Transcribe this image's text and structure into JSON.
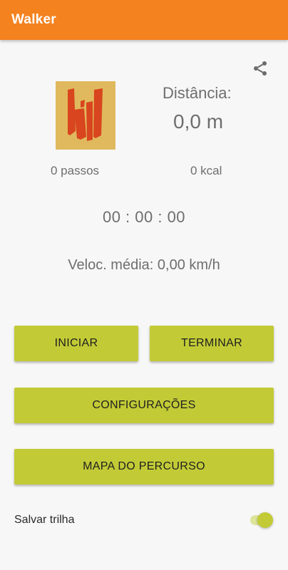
{
  "appbar": {
    "title": "Walker",
    "color": "#f4821f"
  },
  "share": {
    "icon": "share-icon"
  },
  "logo": {
    "icon": "walker-logo",
    "background": "#e0b95e",
    "glyph_color": "#d8451e"
  },
  "stats": {
    "distance_label": "Distância:",
    "distance_value": "0,0 m",
    "steps": "0 passos",
    "calories": "0 kcal",
    "timer": "00 : 00 : 00",
    "avg_speed": "Veloc. média: 0,00 km/h"
  },
  "buttons": {
    "start": "INICIAR",
    "end": "TERMINAR",
    "settings": "CONFIGURAÇÕES",
    "route_map": "MAPA DO PERCURSO",
    "color": "#c2cb36"
  },
  "save_trail": {
    "label": "Salvar trilha",
    "enabled": true
  }
}
